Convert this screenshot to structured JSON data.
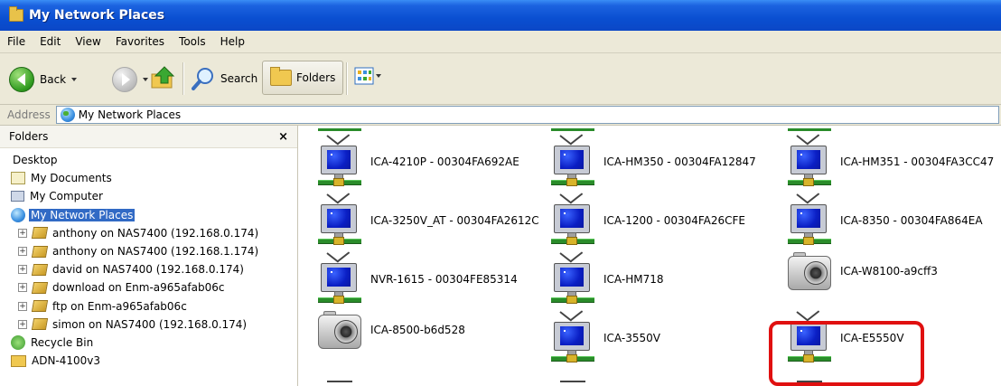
{
  "window": {
    "title": "My Network Places"
  },
  "menu": [
    "File",
    "Edit",
    "View",
    "Favorites",
    "Tools",
    "Help"
  ],
  "toolbar": {
    "back": "Back",
    "search": "Search",
    "folders": "Folders"
  },
  "address": {
    "label": "Address",
    "value": "My Network Places"
  },
  "folders_pane": {
    "title": "Folders",
    "close": "×",
    "items": [
      {
        "label": "Desktop",
        "icon": "none",
        "expand": false,
        "indent": 0
      },
      {
        "label": "My Documents",
        "icon": "doc",
        "expand": false,
        "indent": 0
      },
      {
        "label": "My Computer",
        "icon": "comp",
        "expand": false,
        "indent": 0
      },
      {
        "label": "My Network Places",
        "icon": "netp",
        "expand": false,
        "indent": 0,
        "selected": true
      },
      {
        "label": "anthony on NAS7400 (192.168.0.174)",
        "icon": "share",
        "expand": true,
        "indent": 1
      },
      {
        "label": "anthony on NAS7400 (192.168.1.174)",
        "icon": "share",
        "expand": true,
        "indent": 1
      },
      {
        "label": "david on NAS7400 (192.168.0.174)",
        "icon": "share",
        "expand": true,
        "indent": 1
      },
      {
        "label": "download on Enm-a965afab06c",
        "icon": "share",
        "expand": true,
        "indent": 1
      },
      {
        "label": "ftp on Enm-a965afab06c",
        "icon": "share",
        "expand": true,
        "indent": 1
      },
      {
        "label": "simon on NAS7400 (192.168.0.174)",
        "icon": "share",
        "expand": true,
        "indent": 1
      },
      {
        "label": "Recycle Bin",
        "icon": "recycle",
        "expand": false,
        "indent": 0
      },
      {
        "label": "ADN-4100v3",
        "icon": "fold",
        "expand": false,
        "indent": 0
      }
    ]
  },
  "network_items": [
    {
      "label": "ICA-4210P - 00304FA692AE",
      "icon": "monitor",
      "col": 0,
      "row": 0
    },
    {
      "label": "ICA-HM350 - 00304FA12847",
      "icon": "monitor",
      "col": 1,
      "row": 0
    },
    {
      "label": "ICA-HM351 - 00304FA3CC47",
      "icon": "monitor",
      "col": 2,
      "row": 0
    },
    {
      "label": "ICA-3250V_AT - 00304FA2612C",
      "icon": "monitor",
      "col": 0,
      "row": 1
    },
    {
      "label": "ICA-1200 - 00304FA26CFE",
      "icon": "monitor",
      "col": 1,
      "row": 1
    },
    {
      "label": "ICA-8350 - 00304FA864EA",
      "icon": "monitor",
      "col": 2,
      "row": 1
    },
    {
      "label": "NVR-1615 - 00304FE85314",
      "icon": "monitor",
      "col": 0,
      "row": 2
    },
    {
      "label": "ICA-HM718",
      "icon": "monitor",
      "col": 1,
      "row": 2
    },
    {
      "label": "ICA-W8100-a9cff3",
      "icon": "camera",
      "col": 2,
      "row": 2
    },
    {
      "label": "ICA-8500-b6d528",
      "icon": "camera",
      "col": 0,
      "row": 3
    },
    {
      "label": "ICA-3550V",
      "icon": "monitor",
      "col": 1,
      "row": 3
    },
    {
      "label": "ICA-E5550V",
      "icon": "monitor",
      "col": 2,
      "row": 3
    }
  ],
  "colors": {
    "title_bar": "#0a4fd1",
    "selection": "#316ac5",
    "highlight": "#e01010"
  }
}
